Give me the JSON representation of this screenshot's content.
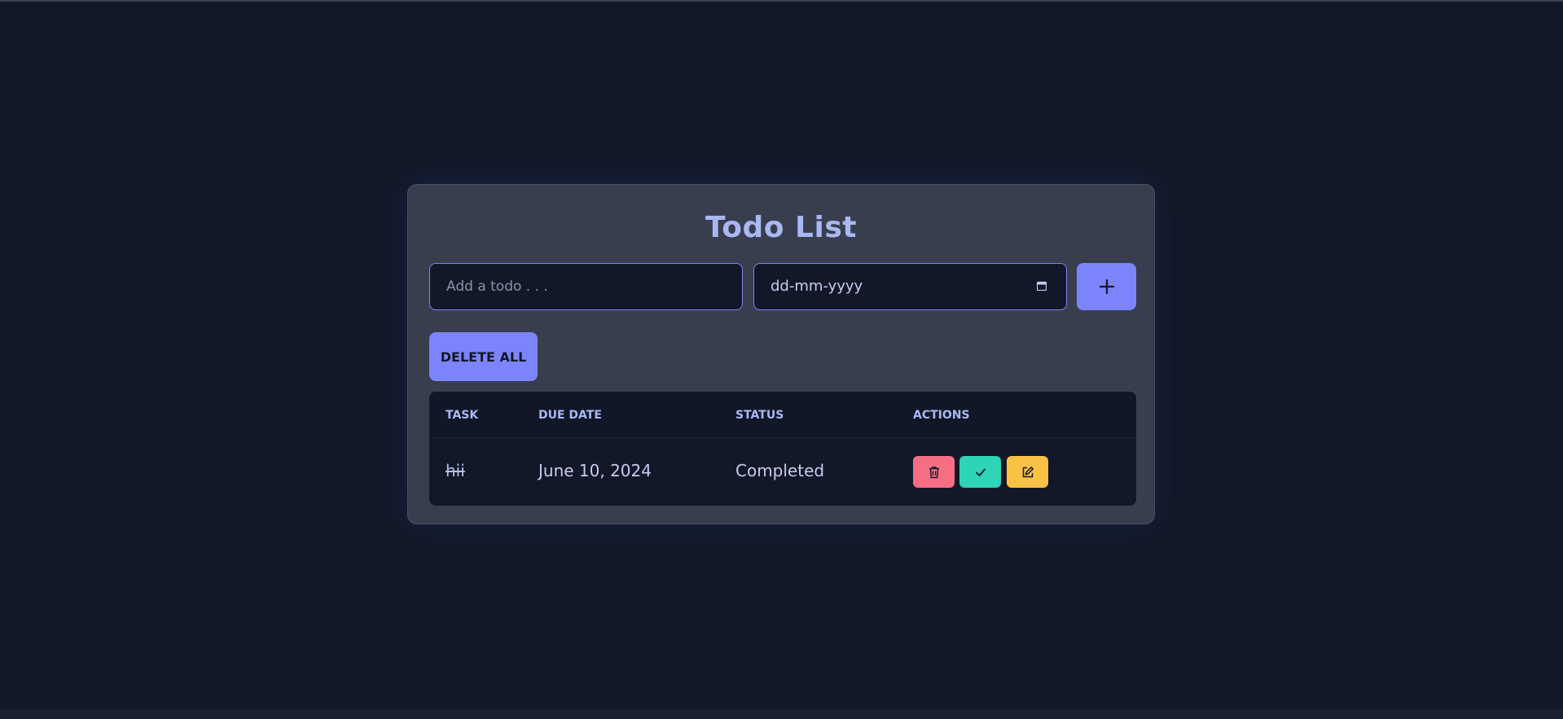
{
  "app": {
    "title": "Todo List"
  },
  "form": {
    "todo_placeholder": "Add a todo . . .",
    "todo_value": "",
    "date_display": "dd-mm-yyyy",
    "add_icon": "plus-icon"
  },
  "controls": {
    "delete_all_label": "DELETE ALL"
  },
  "table": {
    "headers": [
      "TASK",
      "DUE DATE",
      "STATUS",
      "ACTIONS"
    ],
    "rows": [
      {
        "task": "hii",
        "due_date": "June 10, 2024",
        "status": "Completed",
        "actions": [
          "trash-icon",
          "check-icon",
          "edit-icon"
        ]
      }
    ]
  },
  "colors": {
    "background": "#121827",
    "card": "#383e4e",
    "accent": "#7d84fb",
    "title": "#a9b8f3",
    "delete": "#f76e84",
    "complete": "#2fd3b5",
    "edit": "#f9c247"
  }
}
